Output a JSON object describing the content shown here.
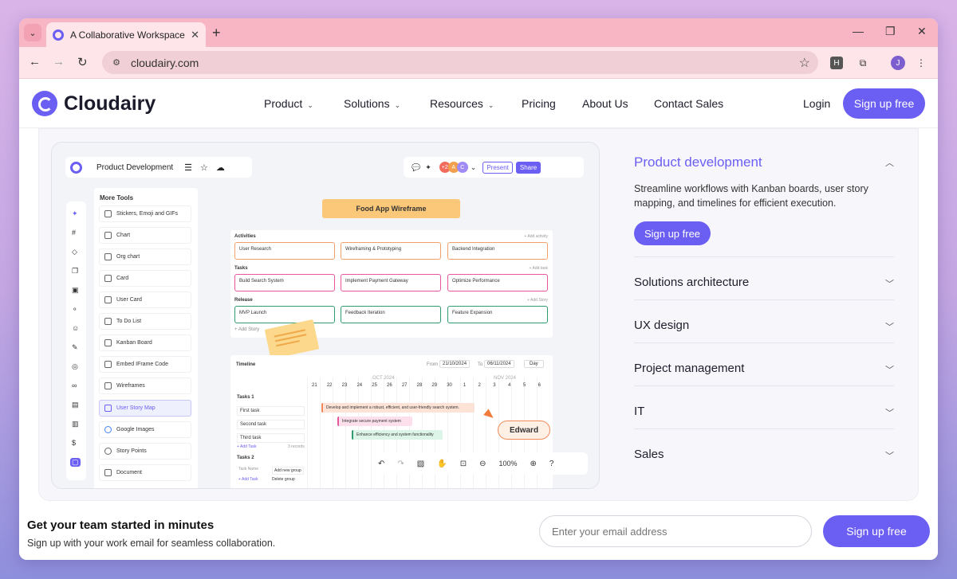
{
  "browser": {
    "tab_title": "A Collaborative Workspace | Clo",
    "url": "cloudairy.com",
    "profile_initial": "J",
    "ext_letter": "H"
  },
  "header": {
    "brand": "Cloudairy",
    "nav": [
      "Product",
      "Solutions",
      "Resources",
      "Pricing",
      "About Us",
      "Contact Sales"
    ],
    "login": "Login",
    "signup": "Sign up free"
  },
  "app": {
    "doc_title": "Product Development",
    "present": "Present",
    "share": "Share",
    "avatars": [
      "+2",
      "A",
      "C"
    ],
    "more_tools": "More Tools",
    "tools": [
      "Stickers, Emoji and GIFs",
      "Chart",
      "Org chart",
      "Card",
      "User Card",
      "To Do List",
      "Kanban Board",
      "Embed IFrame Code",
      "Wireframes",
      "User Story Map",
      "Google Images",
      "Story Points",
      "Document"
    ],
    "frame_title": "Food App Wireframe",
    "activities": "Activities",
    "add_activity": "+ Add activity",
    "activity_cards": [
      "User Research",
      "Wireframing & Prototyping",
      "Backend Integration"
    ],
    "tasks": "Tasks",
    "add_task": "+ Add task",
    "task_cards": [
      "Build Search System",
      "Implement Payment Gateway",
      "Optimize Performance"
    ],
    "release": "Release",
    "add_story": "+ Add Story",
    "release_cards": [
      "MVP Launch",
      "Feedback Iteration",
      "Feature Expansion"
    ],
    "add_story2": "+ Add Story",
    "timeline": "Timeline",
    "from": "From",
    "from_date": "21/10/2024",
    "to": "To",
    "to_date": "06/11/2024",
    "day": "Day",
    "oct": "OCT 2024",
    "nov": "NOV 2024",
    "days": [
      "21",
      "22",
      "23",
      "24",
      "25",
      "26",
      "27",
      "28",
      "29",
      "30",
      "1",
      "2",
      "3",
      "4",
      "5",
      "6"
    ],
    "tasks1": "Tasks 1",
    "task_rows": [
      "First task",
      "Second task",
      "Third task"
    ],
    "add_task2": "+ Add Task",
    "records": "3 records",
    "tasks2": "Tasks 2",
    "task_name": "Task Name",
    "add_task3": "+ Add Task",
    "add_group": "Add new group",
    "delete_group": "Delete group",
    "bars": [
      "Develop and implement a robust, efficient, and user-friendly search system.",
      "Integrate secure payment system",
      "Enhance efficiency and system functionality"
    ],
    "edward": "Edward",
    "zoom": "100%"
  },
  "accordion": [
    {
      "title": "Product development",
      "desc": "Streamline workflows with Kanban boards, user story mapping, and timelines for efficient execution.",
      "cta": "Sign up free"
    },
    {
      "title": "Solutions architecture"
    },
    {
      "title": "UX design"
    },
    {
      "title": "Project management"
    },
    {
      "title": "IT"
    },
    {
      "title": "Sales"
    }
  ],
  "bottom": {
    "title": "Get your team started in minutes",
    "subtitle": "Sign up with your work email for seamless collaboration.",
    "placeholder": "Enter your email address",
    "cta": "Sign up free"
  },
  "colors": {
    "accent": "#6b5ef2",
    "tab_bar": "#f8b6c4"
  }
}
